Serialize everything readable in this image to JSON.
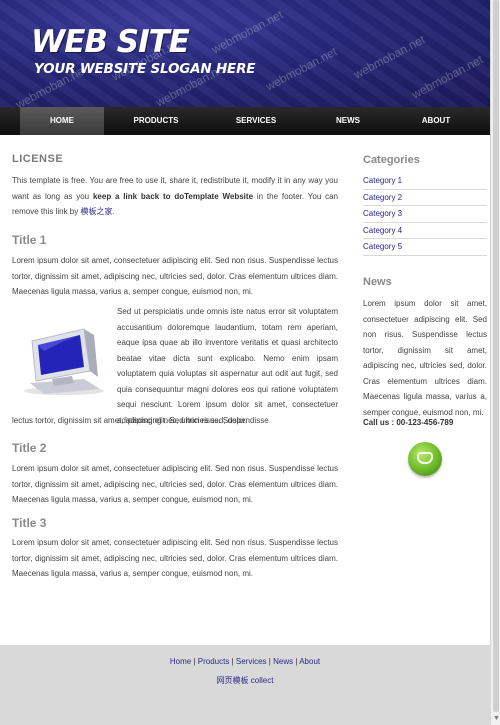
{
  "header": {
    "logo_main": "WEB SITE",
    "slogan": "YOUR WEBSITE SLOGAN HERE",
    "watermark": "webmoban.net"
  },
  "nav": {
    "items": [
      "HOME",
      "PRODUCTS",
      "SERVICES",
      "NEWS",
      "ABOUT"
    ],
    "active": "HOME"
  },
  "main": {
    "license_heading": "LICENSE",
    "license_text_1": "This template is free. You are free to use it, share it, redistribute it, modify it in any way you want as long as you ",
    "license_text_bold": "keep a link back to doTemplate Website",
    "license_text_2": " in the footer. You can remove this link by ",
    "license_link": "模板之家",
    "license_text_end": ".",
    "title1": "Title 1",
    "title1_p1": "Lorem ipsum dolor sit amet, consectetuer adipiscing elit. Sed non risus. Suspendisse lectus tortor, dignissim sit amet, adipiscing nec, ultricies sed, dolor. Cras elementum ultrices diam. Maecenas ligula massa, varius a, semper congue, euismod non, mi.",
    "title1_p2": "Sed ut perspiciatis unde omnis iste natus error sit voluptatem accusantium doloremque laudantium, totam rem aperiam, eaque ipsa quae ab illo inventore veritatis et quasi architecto beatae vitae dicta sunt explicabo. Nemo enim ipsam voluptatem quia voluptas sit aspernatur aut odit aut fugit, sed quia consequuntur magni dolores eos qui ratione voluptatem sequi nesciunt. Lorem ipsum dolor sit amet, consectetuer adipiscing elit. Sed non risus. Suspendisse",
    "title1_p2_tail": "lectus tortor, dignissim sit amet, adipiscing nec, ultricies sed, dolor.",
    "title2": "Title 2",
    "title2_p": "Lorem ipsum dolor sit amet, consectetuer adipiscing elit. Sed non risus. Suspendisse lectus tortor, dignissim sit amet, adipiscing nec, ultricies sed, dolor. Cras elementum ultrices diam. Maecenas ligula massa, varius a, semper congue, euismod non, mi.",
    "title3": "Title 3",
    "title3_p": "Lorem ipsum dolor sit amet, consectetuer adipiscing elit. Sed non risus. Suspendisse lectus tortor, dignissim sit amet, adipiscing nec, ultricies sed, dolor. Cras elementum ultrices diam. Maecenas ligula massa, varius a, semper congue, euismod non, mi."
  },
  "sidebar": {
    "categories_heading": "Categories",
    "categories": [
      "Category 1",
      "Category 2",
      "Category 3",
      "Category 4",
      "Category 5"
    ],
    "news_heading": "News",
    "news_text": "Lorem ipsum dolor sit amet, consectetuer adipiscing elit. Sed non risus. Suspendisse lectus tortor, dignissim sit amet, adipiscing nec, ultricies sed, dolor. Cras elementum ultrices diam. Maecenas ligula massa, varius a, semper congue, euismod non, mi.",
    "call_us": "Call us : 00-123-456-789"
  },
  "footer": {
    "links": [
      "Home",
      "Products",
      "Services",
      "News",
      "About"
    ],
    "separator": "|",
    "note": "网页模板 collect"
  },
  "colors": {
    "header_bg": "#262678",
    "nav_bg": "#1a1a1a",
    "link": "#2a2a8a",
    "footer_bg": "#d9d9d9"
  }
}
